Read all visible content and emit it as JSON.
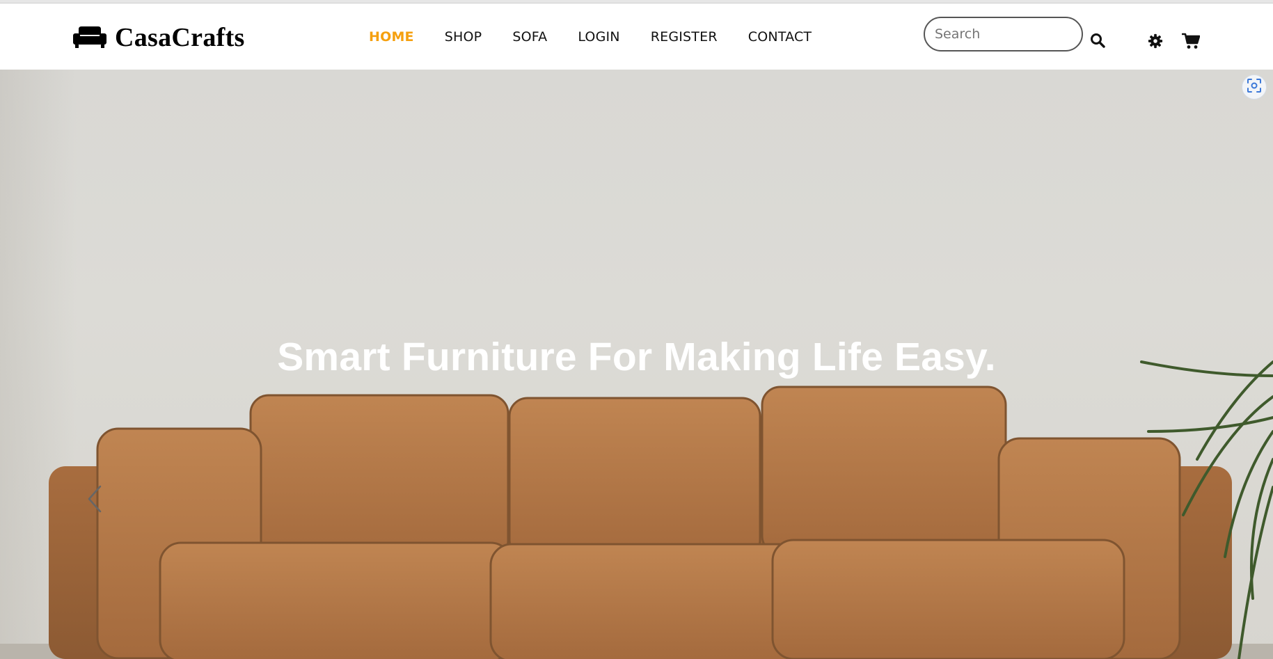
{
  "brand": {
    "name": "CasaCrafts",
    "logo_icon": "sofa-icon"
  },
  "nav": {
    "items": [
      {
        "label": "HOME",
        "active": true
      },
      {
        "label": "SHOP",
        "active": false
      },
      {
        "label": "SOFA",
        "active": false
      },
      {
        "label": "LOGIN",
        "active": false
      },
      {
        "label": "REGISTER",
        "active": false
      },
      {
        "label": "CONTACT",
        "active": false
      }
    ]
  },
  "search": {
    "placeholder": "Search",
    "value": "",
    "icon": "search-icon"
  },
  "toolbar": {
    "settings_icon": "gear-icon",
    "cart_icon": "cart-icon"
  },
  "hero": {
    "title": "Smart Furniture For Making Life Easy.",
    "prev_icon": "chevron-left-icon",
    "image": "leather-sofa-photo"
  },
  "overlay": {
    "capture_icon": "screen-capture-icon"
  },
  "colors": {
    "accent": "#f5a00f",
    "text": "#111111",
    "hero_title": "#ffffff",
    "sofa_leather": "#b57a4b"
  }
}
